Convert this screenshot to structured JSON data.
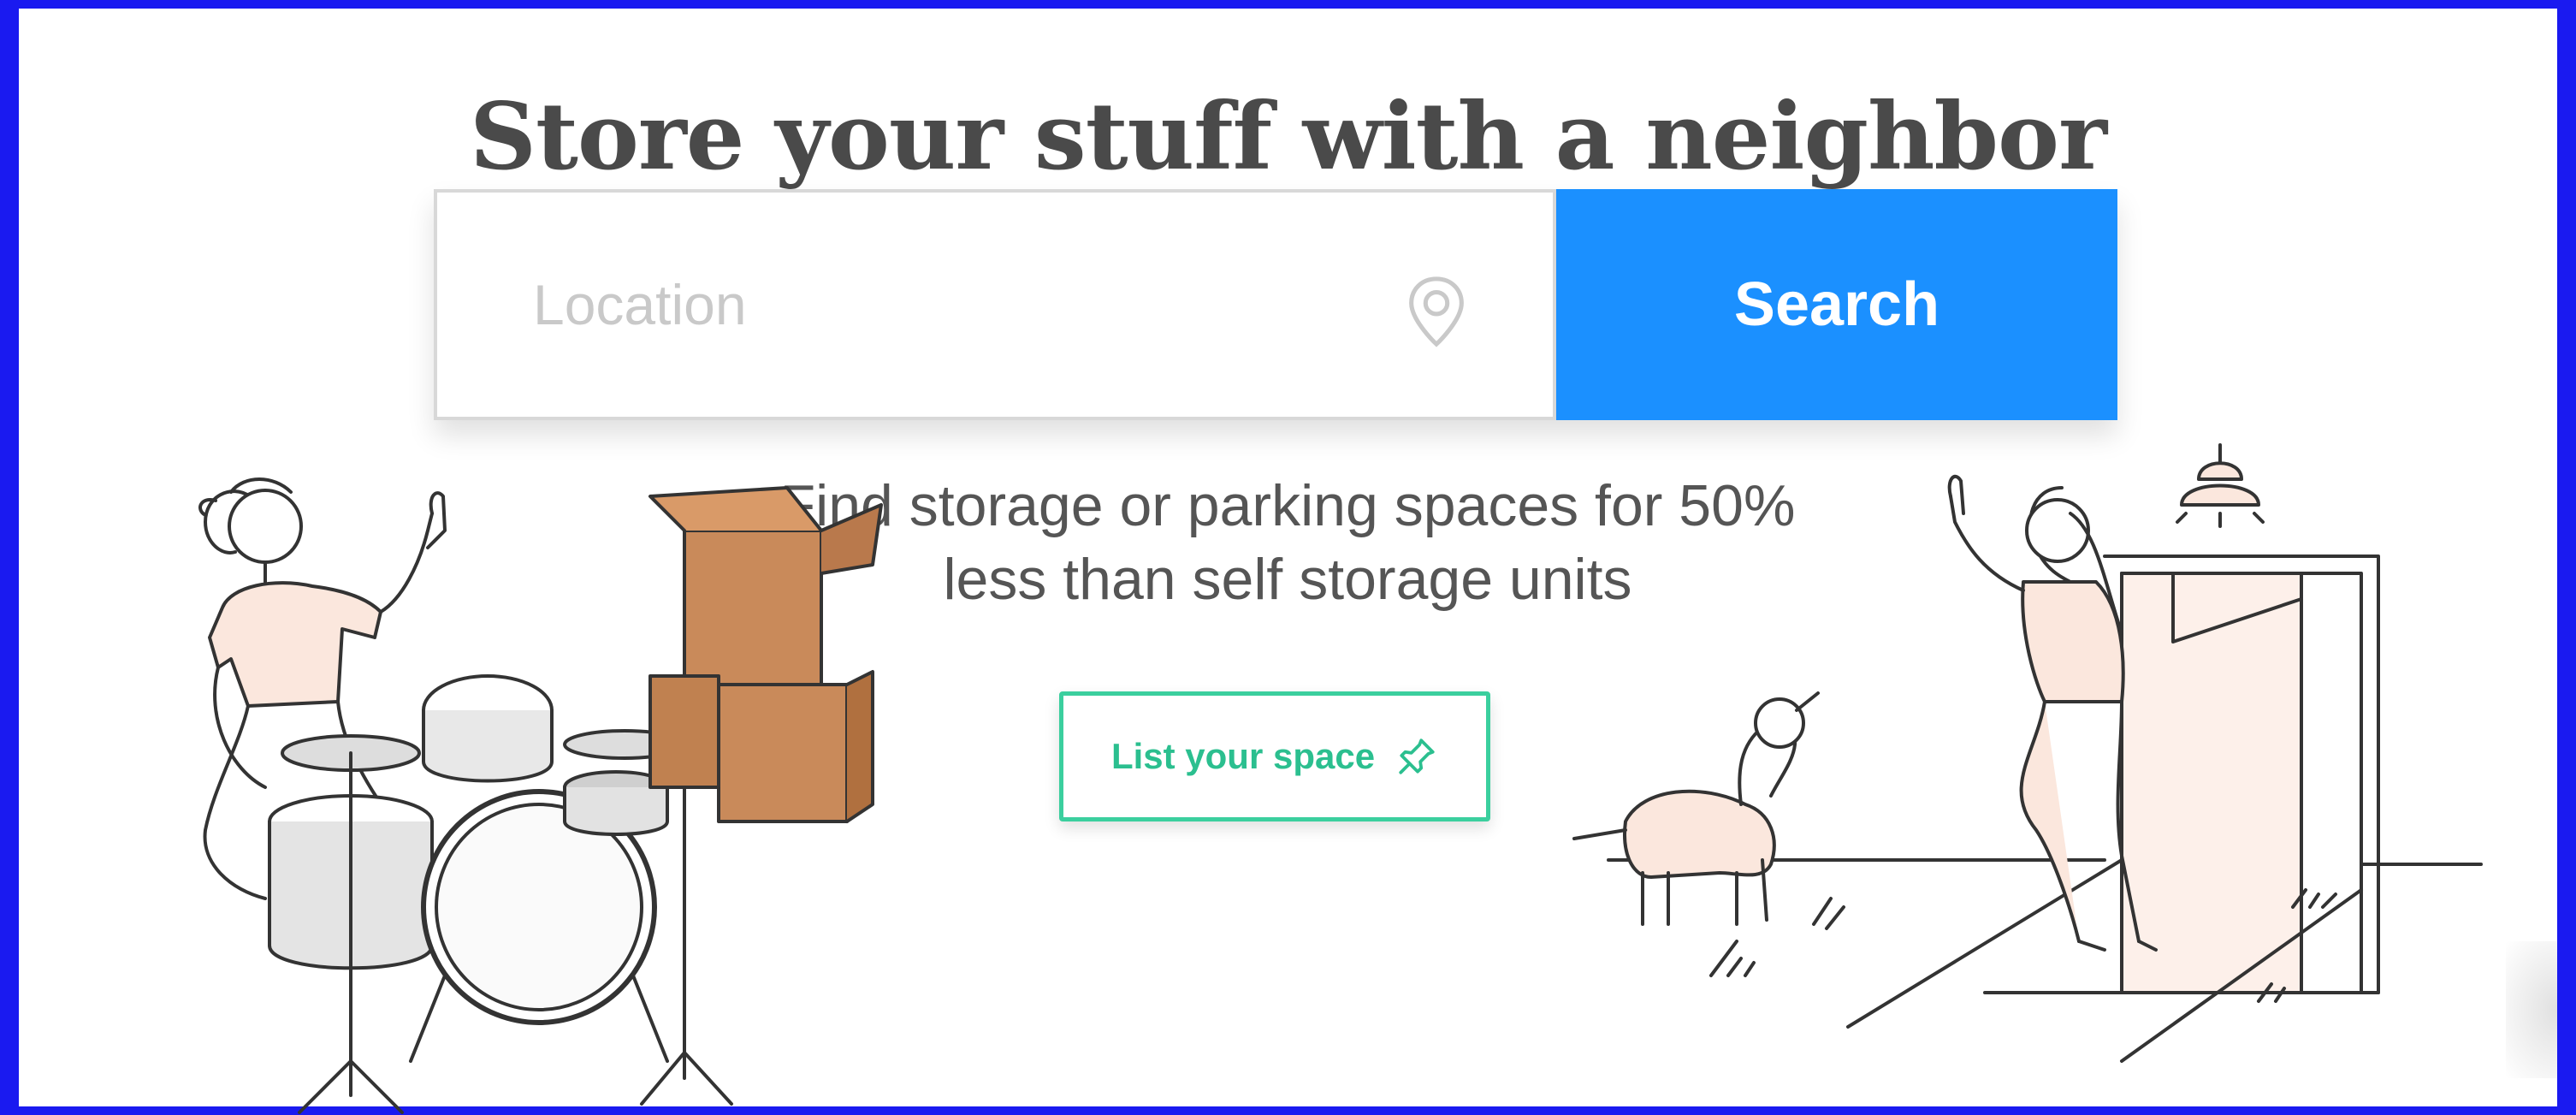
{
  "hero": {
    "title": "Store your stuff with a neighbor",
    "tagline_line1": "Find storage or parking spaces for 50%",
    "tagline_line2": "less than self storage units"
  },
  "search": {
    "location_placeholder": "Location",
    "location_value": "",
    "location_icon": "map-pin-icon",
    "button_label": "Search",
    "button_color": "#1b90ff"
  },
  "list_space": {
    "label": "List your space",
    "icon": "pushpin-icon",
    "accent_color": "#3bcf9e"
  },
  "illustrations": {
    "left": "person-with-drums-and-boxes",
    "right": "person-with-dog-at-garage-door"
  },
  "colors": {
    "frame": "#1a1af0",
    "title_text": "#4a4a4a",
    "body_text": "#555555"
  }
}
